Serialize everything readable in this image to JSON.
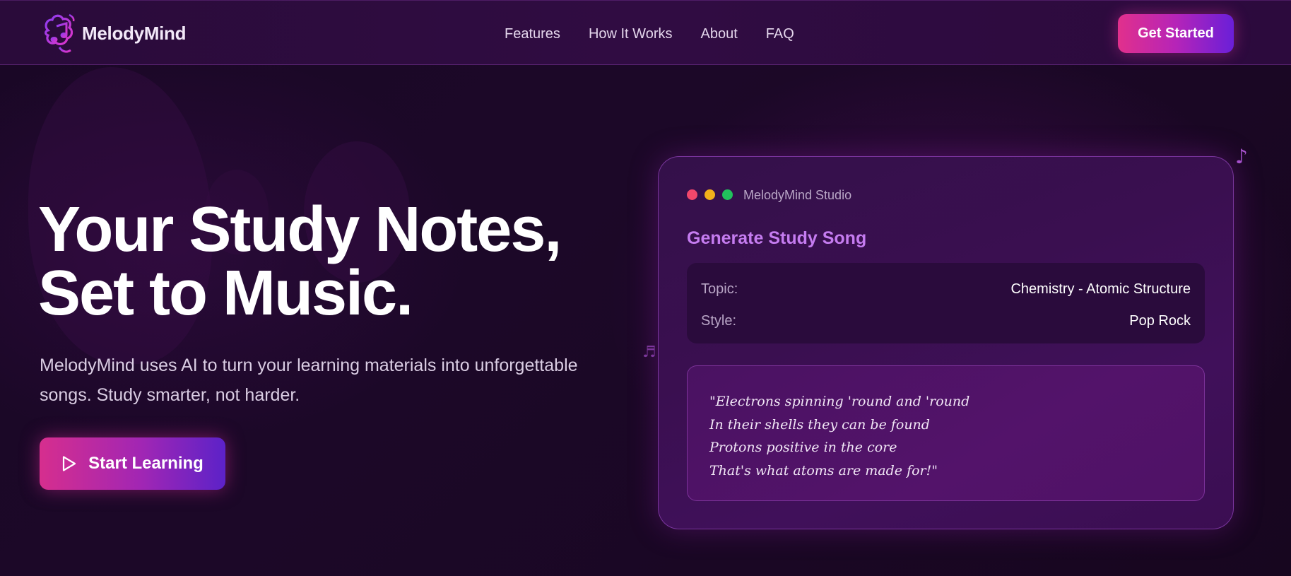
{
  "brand": {
    "name": "MelodyMind"
  },
  "nav": {
    "items": [
      {
        "label": "Features"
      },
      {
        "label": "How It Works"
      },
      {
        "label": "About"
      },
      {
        "label": "FAQ"
      }
    ],
    "cta_label": "Get Started"
  },
  "hero": {
    "title_line1": "Your Study Notes,",
    "title_line2": "Set to Music.",
    "subtitle_line1": "MelodyMind uses AI to turn your learning materials into unforgettable",
    "subtitle_line2": "songs. Study smarter, not harder.",
    "button_label": "Start Learning",
    "button_icon": "play-icon"
  },
  "studio": {
    "window_title": "MelodyMind Studio",
    "heading": "Generate Study Song",
    "fields": [
      {
        "label": "Topic:",
        "value": "Chemistry - Atomic Structure"
      },
      {
        "label": "Style:",
        "value": "Pop Rock"
      }
    ],
    "lyrics": [
      "\"Electrons spinning 'round and 'round",
      "In their shells they can be found",
      "Protons positive in the core",
      "That's what atoms are made for!\""
    ]
  },
  "decorations": {
    "note_top": "♪",
    "note_mid": "♬"
  },
  "colors": {
    "accent_pink": "#e1308c",
    "accent_purple": "#6a1fd8",
    "heading_violet": "#c57cf0",
    "background": "#1a0726"
  }
}
